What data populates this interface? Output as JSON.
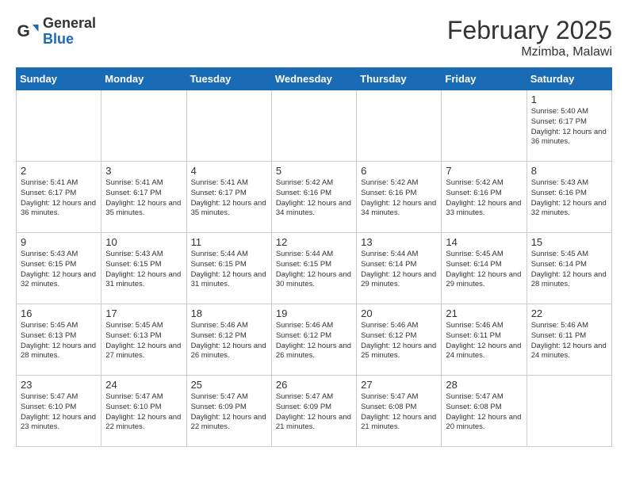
{
  "header": {
    "logo_general": "General",
    "logo_blue": "Blue",
    "month_title": "February 2025",
    "location": "Mzimba, Malawi"
  },
  "weekdays": [
    "Sunday",
    "Monday",
    "Tuesday",
    "Wednesday",
    "Thursday",
    "Friday",
    "Saturday"
  ],
  "weeks": [
    [
      {
        "day": "",
        "info": ""
      },
      {
        "day": "",
        "info": ""
      },
      {
        "day": "",
        "info": ""
      },
      {
        "day": "",
        "info": ""
      },
      {
        "day": "",
        "info": ""
      },
      {
        "day": "",
        "info": ""
      },
      {
        "day": "1",
        "info": "Sunrise: 5:40 AM\nSunset: 6:17 PM\nDaylight: 12 hours and 36 minutes."
      }
    ],
    [
      {
        "day": "2",
        "info": "Sunrise: 5:41 AM\nSunset: 6:17 PM\nDaylight: 12 hours and 36 minutes."
      },
      {
        "day": "3",
        "info": "Sunrise: 5:41 AM\nSunset: 6:17 PM\nDaylight: 12 hours and 35 minutes."
      },
      {
        "day": "4",
        "info": "Sunrise: 5:41 AM\nSunset: 6:17 PM\nDaylight: 12 hours and 35 minutes."
      },
      {
        "day": "5",
        "info": "Sunrise: 5:42 AM\nSunset: 6:16 PM\nDaylight: 12 hours and 34 minutes."
      },
      {
        "day": "6",
        "info": "Sunrise: 5:42 AM\nSunset: 6:16 PM\nDaylight: 12 hours and 34 minutes."
      },
      {
        "day": "7",
        "info": "Sunrise: 5:42 AM\nSunset: 6:16 PM\nDaylight: 12 hours and 33 minutes."
      },
      {
        "day": "8",
        "info": "Sunrise: 5:43 AM\nSunset: 6:16 PM\nDaylight: 12 hours and 32 minutes."
      }
    ],
    [
      {
        "day": "9",
        "info": "Sunrise: 5:43 AM\nSunset: 6:15 PM\nDaylight: 12 hours and 32 minutes."
      },
      {
        "day": "10",
        "info": "Sunrise: 5:43 AM\nSunset: 6:15 PM\nDaylight: 12 hours and 31 minutes."
      },
      {
        "day": "11",
        "info": "Sunrise: 5:44 AM\nSunset: 6:15 PM\nDaylight: 12 hours and 31 minutes."
      },
      {
        "day": "12",
        "info": "Sunrise: 5:44 AM\nSunset: 6:15 PM\nDaylight: 12 hours and 30 minutes."
      },
      {
        "day": "13",
        "info": "Sunrise: 5:44 AM\nSunset: 6:14 PM\nDaylight: 12 hours and 29 minutes."
      },
      {
        "day": "14",
        "info": "Sunrise: 5:45 AM\nSunset: 6:14 PM\nDaylight: 12 hours and 29 minutes."
      },
      {
        "day": "15",
        "info": "Sunrise: 5:45 AM\nSunset: 6:14 PM\nDaylight: 12 hours and 28 minutes."
      }
    ],
    [
      {
        "day": "16",
        "info": "Sunrise: 5:45 AM\nSunset: 6:13 PM\nDaylight: 12 hours and 28 minutes."
      },
      {
        "day": "17",
        "info": "Sunrise: 5:45 AM\nSunset: 6:13 PM\nDaylight: 12 hours and 27 minutes."
      },
      {
        "day": "18",
        "info": "Sunrise: 5:46 AM\nSunset: 6:12 PM\nDaylight: 12 hours and 26 minutes."
      },
      {
        "day": "19",
        "info": "Sunrise: 5:46 AM\nSunset: 6:12 PM\nDaylight: 12 hours and 26 minutes."
      },
      {
        "day": "20",
        "info": "Sunrise: 5:46 AM\nSunset: 6:12 PM\nDaylight: 12 hours and 25 minutes."
      },
      {
        "day": "21",
        "info": "Sunrise: 5:46 AM\nSunset: 6:11 PM\nDaylight: 12 hours and 24 minutes."
      },
      {
        "day": "22",
        "info": "Sunrise: 5:46 AM\nSunset: 6:11 PM\nDaylight: 12 hours and 24 minutes."
      }
    ],
    [
      {
        "day": "23",
        "info": "Sunrise: 5:47 AM\nSunset: 6:10 PM\nDaylight: 12 hours and 23 minutes."
      },
      {
        "day": "24",
        "info": "Sunrise: 5:47 AM\nSunset: 6:10 PM\nDaylight: 12 hours and 22 minutes."
      },
      {
        "day": "25",
        "info": "Sunrise: 5:47 AM\nSunset: 6:09 PM\nDaylight: 12 hours and 22 minutes."
      },
      {
        "day": "26",
        "info": "Sunrise: 5:47 AM\nSunset: 6:09 PM\nDaylight: 12 hours and 21 minutes."
      },
      {
        "day": "27",
        "info": "Sunrise: 5:47 AM\nSunset: 6:08 PM\nDaylight: 12 hours and 21 minutes."
      },
      {
        "day": "28",
        "info": "Sunrise: 5:47 AM\nSunset: 6:08 PM\nDaylight: 12 hours and 20 minutes."
      },
      {
        "day": "",
        "info": ""
      }
    ]
  ]
}
